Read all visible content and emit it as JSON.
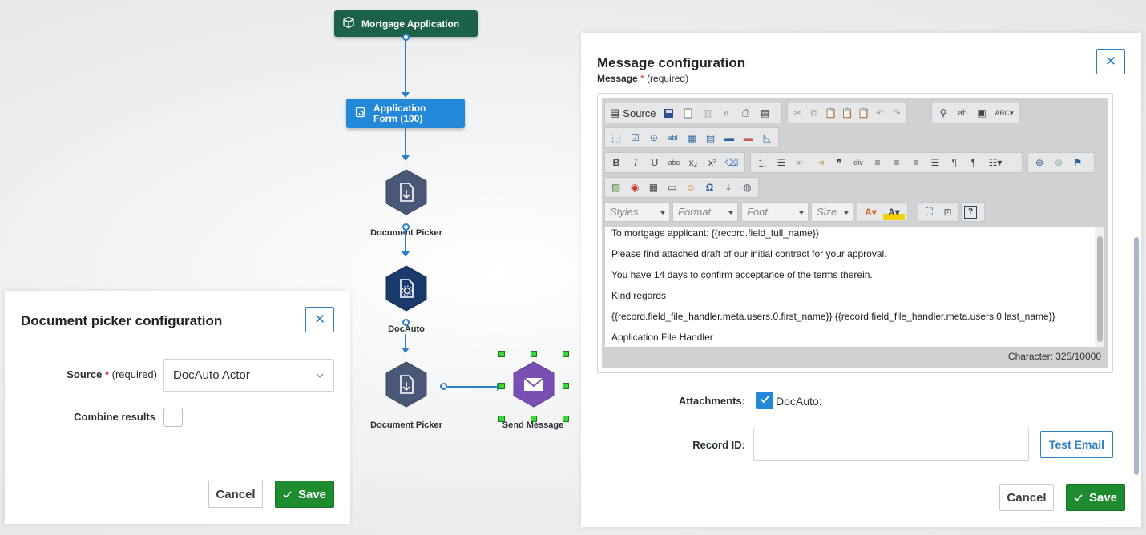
{
  "flow": {
    "start_node": "Mortgage Application",
    "form_node": "Application Form (100)",
    "nodes": {
      "document_picker_1": "Document Picker",
      "docauto": "DocAuto",
      "document_picker_2": "Document Picker",
      "send_message": "Send Message"
    },
    "colors": {
      "start_node": "#1b6248",
      "form_node": "#2488d8",
      "doc_picker": "#4a5878",
      "docauto": "#1b3a6b",
      "send_message": "#7a4fb3",
      "connector": "#2c7fc4"
    }
  },
  "doc_picker_panel": {
    "title": "Document picker configuration",
    "source_label": "Source",
    "required_mark": "*",
    "required_text": "(required)",
    "source_value": "DocAuto Actor",
    "combine_label": "Combine results",
    "cancel_label": "Cancel",
    "save_label": "Save"
  },
  "message_panel": {
    "title": "Message configuration",
    "message_label": "Message",
    "required_mark": "*",
    "required_text": "(required)",
    "toolbar": {
      "source_label": "Source",
      "styles": "Styles",
      "format": "Format",
      "font": "Font",
      "size": "Size"
    },
    "content_lines": [
      "To mortgage applicant: {{record.field_full_name}}",
      "Please find attached draft of our initial contract for your approval.",
      "You have 14 days to confirm acceptance of the terms therein.",
      "Kind regards",
      "{{record.field_file_handler.meta.users.0.first_name}} {{record.field_file_handler.meta.users.0.last_name}}",
      "Application File Handler"
    ],
    "char_count": "Character: 325/10000",
    "attachments_label": "Attachments:",
    "attachment_option": "DocAuto:",
    "record_id_label": "Record ID:",
    "record_id_value": "",
    "test_email_label": "Test Email",
    "cancel_label": "Cancel",
    "save_label": "Save"
  }
}
